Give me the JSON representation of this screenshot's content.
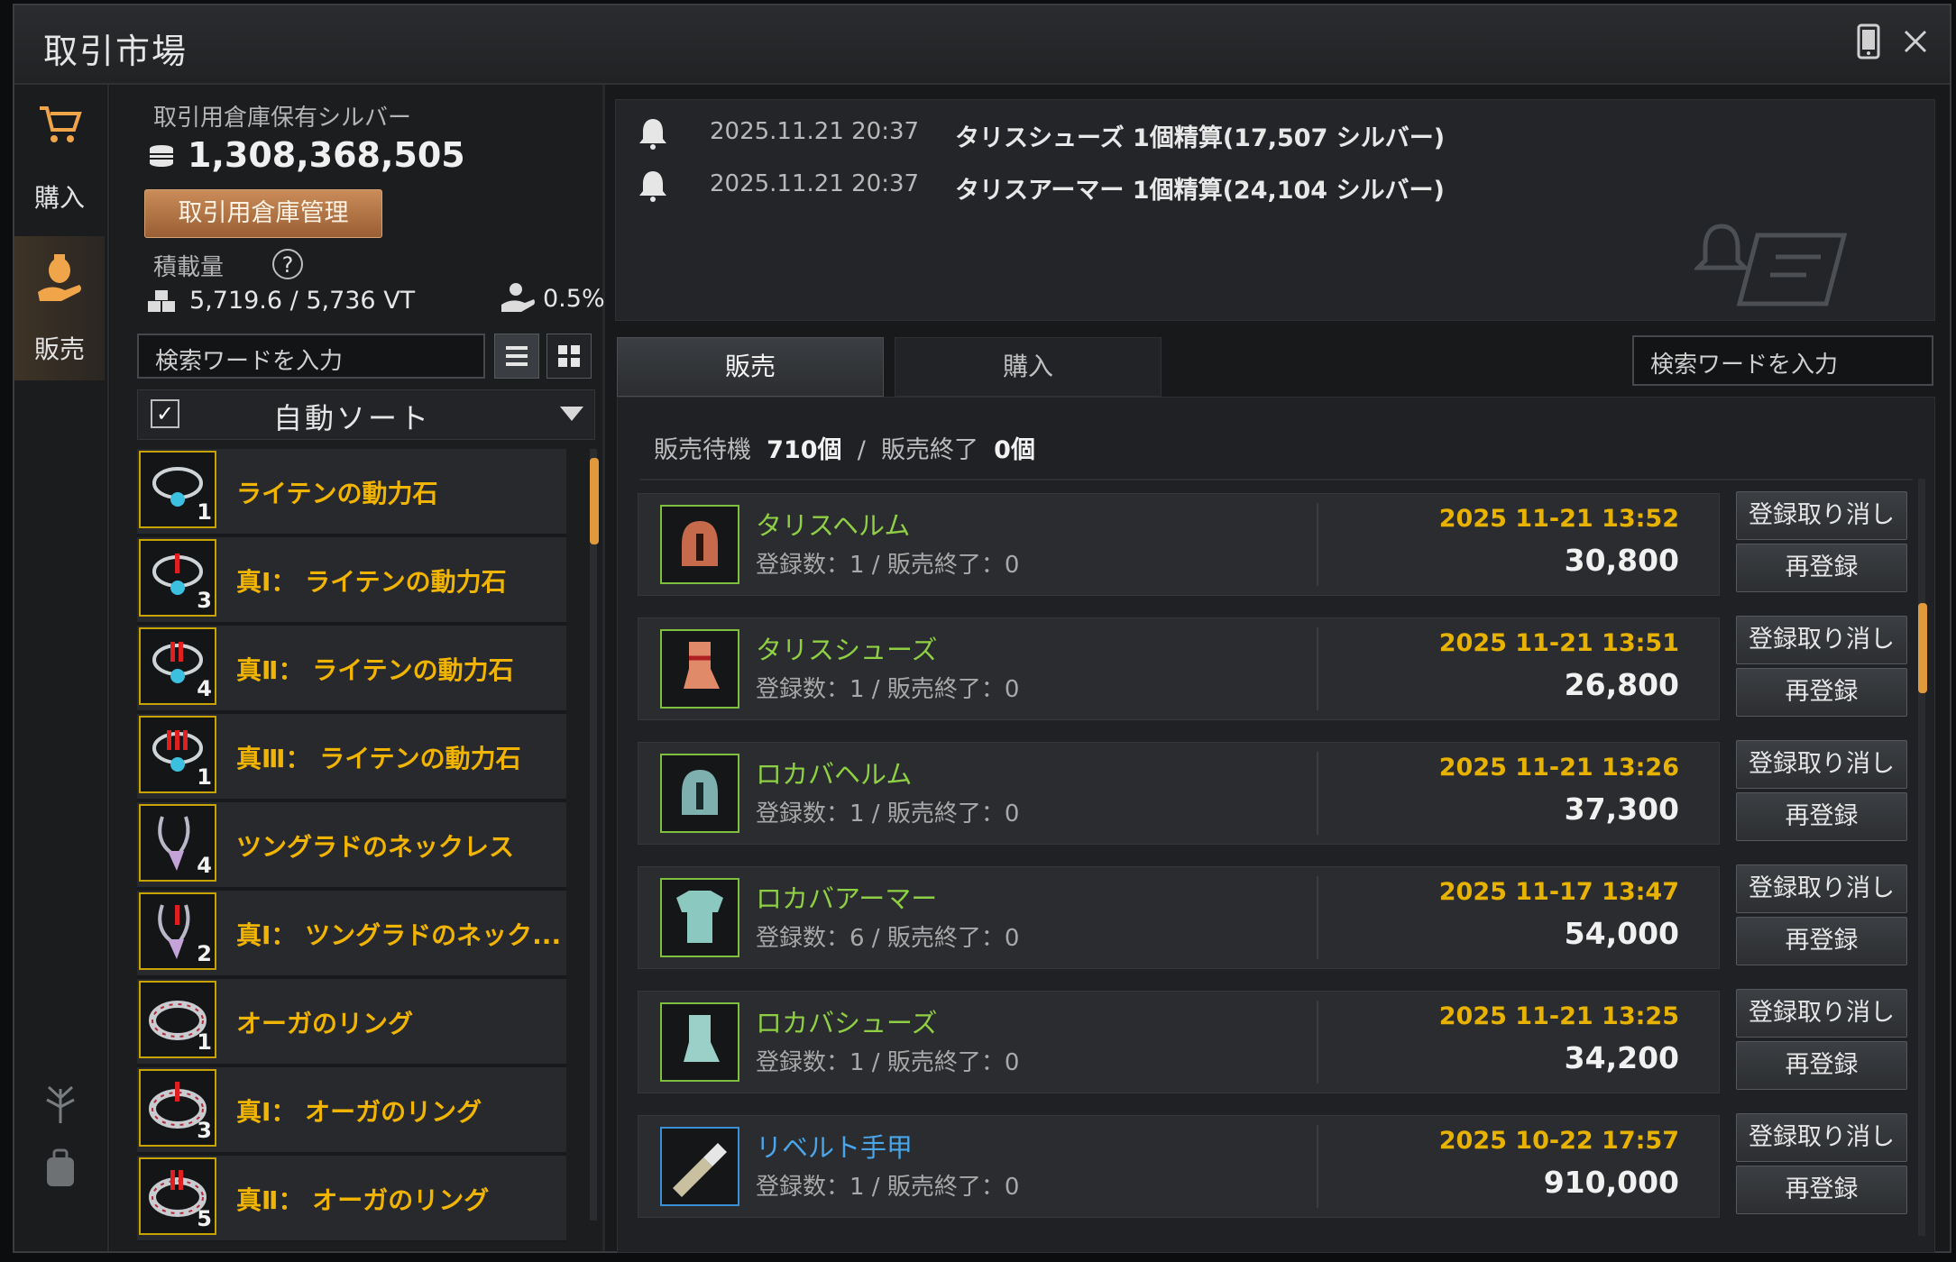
{
  "window": {
    "title": "取引市場"
  },
  "rail": {
    "buy_label": "購入",
    "sell_label": "販売"
  },
  "wallet": {
    "silver_label": "取引用倉庫保有シルバー",
    "silver_amount": "1,308,368,505",
    "manage_button": "取引用倉庫管理",
    "weight_label": "積載量",
    "help": "?",
    "weight_value": "5,719.6 / 5,736 VT",
    "tax_value": "0.5%"
  },
  "left_search": {
    "placeholder": "検索ワードを入力"
  },
  "sort": {
    "label": "自動ソート",
    "checked": true
  },
  "categories": [
    {
      "name": "ライテンの動力石",
      "count": "1"
    },
    {
      "name": "真Ⅰ： ライテンの動力石",
      "count": "3"
    },
    {
      "name": "真Ⅱ： ライテンの動力石",
      "count": "4"
    },
    {
      "name": "真Ⅲ： ライテンの動力石",
      "count": "1"
    },
    {
      "name": "ツングラドのネックレス",
      "count": "4"
    },
    {
      "name": "真Ⅰ： ツングラドのネック...",
      "count": "2"
    },
    {
      "name": "オーガのリング",
      "count": "1"
    },
    {
      "name": "真Ⅰ： オーガのリング",
      "count": "3"
    },
    {
      "name": "真Ⅱ： オーガのリング",
      "count": "5"
    }
  ],
  "notifications": [
    {
      "time": "2025.11.21 20:37",
      "message": "タリスシューズ 1個精算(17,507 シルバー)"
    },
    {
      "time": "2025.11.21 20:37",
      "message": "タリスアーマー 1個精算(24,104 シルバー)"
    }
  ],
  "tabs": {
    "sell": "販売",
    "buy": "購入"
  },
  "right_search": {
    "placeholder": "検索ワードを入力"
  },
  "sale_summary": {
    "waiting_label": "販売待機",
    "waiting_count": "710個",
    "sep": "/",
    "done_label": "販売終了",
    "done_count": "0個"
  },
  "actions": {
    "cancel": "登録取り消し",
    "relist": "再登録"
  },
  "sales": [
    {
      "name": "タリスヘルム",
      "sub": "登録数：1 / 販売終了：0",
      "date": "2025 11-21 13:52",
      "price": "30,800",
      "grade": "green",
      "icon": "helmet-icon"
    },
    {
      "name": "タリスシューズ",
      "sub": "登録数：1 / 販売終了：0",
      "date": "2025 11-21 13:51",
      "price": "26,800",
      "grade": "green",
      "icon": "boots-icon"
    },
    {
      "name": "ロカバヘルム",
      "sub": "登録数：1 / 販売終了：0",
      "date": "2025 11-21 13:26",
      "price": "37,300",
      "grade": "green",
      "icon": "helmet-icon"
    },
    {
      "name": "ロカバアーマー",
      "sub": "登録数：6 / 販売終了：0",
      "date": "2025 11-17 13:47",
      "price": "54,000",
      "grade": "green",
      "icon": "armor-icon"
    },
    {
      "name": "ロカバシューズ",
      "sub": "登録数：1 / 販売終了：0",
      "date": "2025 11-21 13:25",
      "price": "34,200",
      "grade": "green",
      "icon": "boots-icon"
    },
    {
      "name": "リベルト手甲",
      "sub": "登録数：1 / 販売終了：0",
      "date": "2025 10-22 17:57",
      "price": "910,000",
      "grade": "blue",
      "icon": "gauntlet-icon"
    }
  ],
  "colors": {
    "accent": "#f1b400",
    "green_grade": "#8fcf44",
    "blue_grade": "#4aa6ea",
    "date": "#e8b300",
    "button_brown": "#b0703f"
  }
}
